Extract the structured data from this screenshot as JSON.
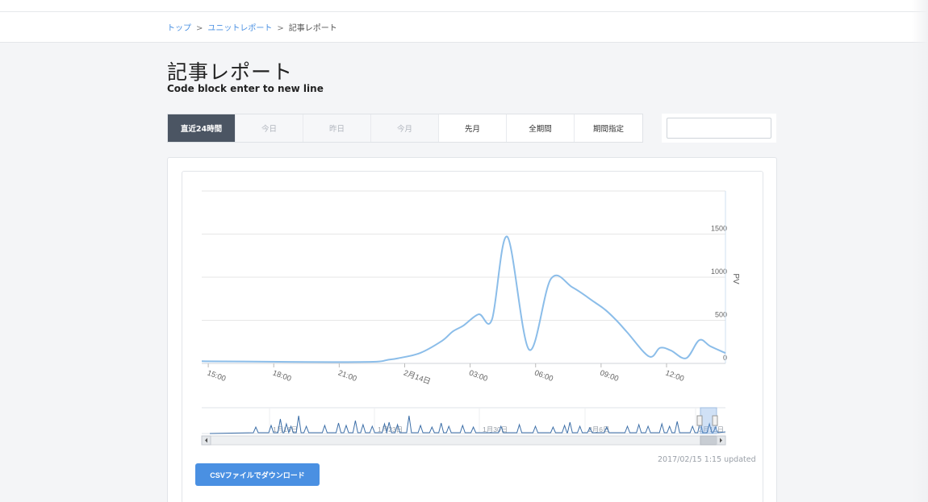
{
  "breadcrumb": {
    "items": [
      "トップ",
      "ユニットレポート",
      "記事レポート"
    ],
    "separator": ">"
  },
  "page": {
    "title": "記事レポート",
    "subtitle": "Code block enter to new line"
  },
  "period_tabs": [
    {
      "label": "直近24時間",
      "state": "active"
    },
    {
      "label": "今日",
      "state": "disabled"
    },
    {
      "label": "昨日",
      "state": "disabled"
    },
    {
      "label": "今月",
      "state": "disabled"
    },
    {
      "label": "先月",
      "state": "normal"
    },
    {
      "label": "全期間",
      "state": "normal"
    },
    {
      "label": "期間指定",
      "state": "normal"
    }
  ],
  "date_input": {
    "value": "",
    "placeholder": ""
  },
  "chart_data": {
    "type": "line",
    "ylabel": "PV",
    "ylim": [
      0,
      2000
    ],
    "yticks": [
      0,
      500,
      1000,
      1500
    ],
    "grid": true,
    "y_axis_side": "right",
    "line_color": "#8bbde9",
    "xticks": [
      "15:00",
      "18:00",
      "21:00",
      "2月14日",
      "03:00",
      "06:00",
      "09:00",
      "12:00"
    ],
    "x": [
      0,
      3,
      6,
      8,
      8.5,
      9,
      10,
      11,
      11.5,
      12,
      12.7,
      13.3,
      14,
      15,
      16,
      17,
      18,
      18.5,
      19,
      19.5,
      20.5,
      21,
      21.5,
      22.2,
      22.8,
      23.3,
      24
    ],
    "values": [
      25,
      20,
      15,
      20,
      40,
      60,
      120,
      260,
      370,
      440,
      570,
      510,
      1470,
      160,
      980,
      880,
      710,
      620,
      500,
      360,
      80,
      180,
      150,
      60,
      270,
      200,
      120
    ],
    "navigator": {
      "labels": [
        "1月16日",
        "1月23日",
        "1月30日",
        "2月6日",
        "2月13日"
      ]
    }
  },
  "updated_text": "2017/02/15 1:15 updated",
  "csv_button": "CSVファイルでダウンロード"
}
